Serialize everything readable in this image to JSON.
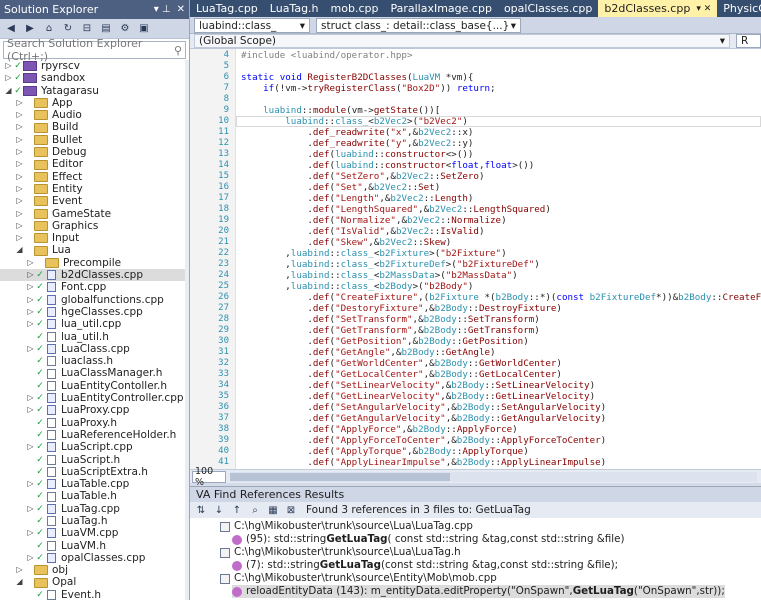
{
  "solution_explorer": {
    "title": "Solution Explorer",
    "pin_icon": "pin-icon",
    "close_icon": "close-icon",
    "search_placeholder": "Search Solution Explorer (Ctrl+;)",
    "search_icon": "search-icon",
    "tree": [
      {
        "label": "rpyrscv",
        "indent": 0,
        "type": "proj",
        "expanded": false,
        "state": "✓"
      },
      {
        "label": "sandbox",
        "indent": 0,
        "type": "proj",
        "expanded": false,
        "state": "✓"
      },
      {
        "label": "Yatagarasu",
        "indent": 0,
        "type": "proj",
        "expanded": true,
        "state": "✓"
      },
      {
        "label": "App",
        "indent": 1,
        "type": "folder",
        "expanded": false
      },
      {
        "label": "Audio",
        "indent": 1,
        "type": "folder",
        "expanded": false
      },
      {
        "label": "Build",
        "indent": 1,
        "type": "folder",
        "expanded": false
      },
      {
        "label": "Bullet",
        "indent": 1,
        "type": "folder",
        "expanded": false
      },
      {
        "label": "Debug",
        "indent": 1,
        "type": "folder",
        "expanded": false
      },
      {
        "label": "Editor",
        "indent": 1,
        "type": "folder",
        "expanded": false
      },
      {
        "label": "Effect",
        "indent": 1,
        "type": "folder",
        "expanded": false
      },
      {
        "label": "Entity",
        "indent": 1,
        "type": "folder",
        "expanded": false
      },
      {
        "label": "Event",
        "indent": 1,
        "type": "folder",
        "expanded": false
      },
      {
        "label": "GameState",
        "indent": 1,
        "type": "folder",
        "expanded": false
      },
      {
        "label": "Graphics",
        "indent": 1,
        "type": "folder",
        "expanded": false
      },
      {
        "label": "Input",
        "indent": 1,
        "type": "folder",
        "expanded": false
      },
      {
        "label": "Lua",
        "indent": 1,
        "type": "folder",
        "expanded": true
      },
      {
        "label": "Precompile",
        "indent": 2,
        "type": "folder",
        "expanded": false
      },
      {
        "label": "b2dClasses.cpp",
        "indent": 2,
        "type": "cpp",
        "expanded": false,
        "state": "✓",
        "selected": true
      },
      {
        "label": "Font.cpp",
        "indent": 2,
        "type": "cpp",
        "expanded": false,
        "state": "✓"
      },
      {
        "label": "globalfunctions.cpp",
        "indent": 2,
        "type": "cpp",
        "expanded": false,
        "state": "✓"
      },
      {
        "label": "hgeClasses.cpp",
        "indent": 2,
        "type": "cpp",
        "expanded": false,
        "state": "✓"
      },
      {
        "label": "lua_util.cpp",
        "indent": 2,
        "type": "cpp",
        "expanded": false,
        "state": "✓"
      },
      {
        "label": "lua_util.h",
        "indent": 2,
        "type": "h",
        "expanded": false,
        "state": "✓"
      },
      {
        "label": "LuaClass.cpp",
        "indent": 2,
        "type": "cpp",
        "expanded": false,
        "state": "✓"
      },
      {
        "label": "luaclass.h",
        "indent": 2,
        "type": "h",
        "expanded": false,
        "state": "✓"
      },
      {
        "label": "LuaClassManager.h",
        "indent": 2,
        "type": "h",
        "expanded": false,
        "state": "✓"
      },
      {
        "label": "LuaEntityContoller.h",
        "indent": 2,
        "type": "h",
        "expanded": false,
        "state": "✓"
      },
      {
        "label": "LuaEntityController.cpp",
        "indent": 2,
        "type": "cpp",
        "expanded": false,
        "state": "✓"
      },
      {
        "label": "LuaProxy.cpp",
        "indent": 2,
        "type": "cpp",
        "expanded": false,
        "state": "✓"
      },
      {
        "label": "LuaProxy.h",
        "indent": 2,
        "type": "h",
        "expanded": false,
        "state": "✓"
      },
      {
        "label": "LuaReferenceHolder.h",
        "indent": 2,
        "type": "h",
        "expanded": false,
        "state": "✓"
      },
      {
        "label": "LuaScript.cpp",
        "indent": 2,
        "type": "cpp",
        "expanded": false,
        "state": "✓"
      },
      {
        "label": "LuaScript.h",
        "indent": 2,
        "type": "h",
        "expanded": false,
        "state": "✓"
      },
      {
        "label": "LuaScriptExtra.h",
        "indent": 2,
        "type": "h",
        "expanded": false,
        "state": "✓"
      },
      {
        "label": "LuaTable.cpp",
        "indent": 2,
        "type": "cpp",
        "expanded": false,
        "state": "✓"
      },
      {
        "label": "LuaTable.h",
        "indent": 2,
        "type": "h",
        "expanded": false,
        "state": "✓"
      },
      {
        "label": "LuaTag.cpp",
        "indent": 2,
        "type": "cpp",
        "expanded": false,
        "state": "✓"
      },
      {
        "label": "LuaTag.h",
        "indent": 2,
        "type": "h",
        "expanded": false,
        "state": "✓"
      },
      {
        "label": "LuaVM.cpp",
        "indent": 2,
        "type": "cpp",
        "expanded": false,
        "state": "✓"
      },
      {
        "label": "LuaVM.h",
        "indent": 2,
        "type": "h",
        "expanded": false,
        "state": "✓"
      },
      {
        "label": "opalClasses.cpp",
        "indent": 2,
        "type": "cpp",
        "expanded": false,
        "state": "✓"
      },
      {
        "label": "obj",
        "indent": 1,
        "type": "folder",
        "expanded": false
      },
      {
        "label": "Opal",
        "indent": 1,
        "type": "folder",
        "expanded": true
      },
      {
        "label": "Event.h",
        "indent": 2,
        "type": "h",
        "expanded": false,
        "state": "✓"
      }
    ]
  },
  "tabs": [
    {
      "label": "LuaTag.cpp",
      "active": false
    },
    {
      "label": "LuaTag.h",
      "active": false
    },
    {
      "label": "mob.cpp",
      "active": false
    },
    {
      "label": "ParallaxImage.cpp",
      "active": false
    },
    {
      "label": "opalClasses.cpp",
      "active": false
    },
    {
      "label": "b2dClasses.cpp",
      "active": true
    },
    {
      "label": "PhysicCompo",
      "active": false
    }
  ],
  "nav": {
    "symbol_combo": "luabind::class_",
    "scope_combo": "struct class_: detail::class_base{...}",
    "global_scope": "(Global Scope)",
    "right_combo": "R"
  },
  "editor": {
    "zoom": "100 %",
    "current_line": 10,
    "lines": [
      {
        "n": 4,
        "html": "<span class=\"inc\">#include &lt;luabind/operator.hpp&gt;</span>"
      },
      {
        "n": 5,
        "html": ""
      },
      {
        "n": 6,
        "html": "<span class=\"kw\">static void</span> <span class=\"fn\">RegisterB2DClasses</span>(<span class=\"ty\">LuaVM</span> *vm){"
      },
      {
        "n": 7,
        "html": "    <span class=\"kw\">if</span>(!vm-&gt;<span class=\"fn\">tryRegisterClass</span>(<span class=\"str\">\"Box2D\"</span>)) <span class=\"kw\">return</span>;"
      },
      {
        "n": 8,
        "html": ""
      },
      {
        "n": 9,
        "html": "    <span class=\"ty\">luabind</span>::<span class=\"fn\">module</span>(vm-&gt;<span class=\"fn\">getState</span>())["
      },
      {
        "n": 10,
        "html": "        <span class=\"ty\">luabind</span>::<span class=\"ty\">class_</span>&lt;<span class=\"ty\">b2Vec2</span>&gt;(<span class=\"str\">\"b2Vec2\"</span>)"
      },
      {
        "n": 11,
        "html": "            .<span class=\"fn\">def_readwrite</span>(<span class=\"str\">\"x\"</span>,&amp;<span class=\"ty\">b2Vec2</span>::x)"
      },
      {
        "n": 12,
        "html": "            .<span class=\"fn\">def_readwrite</span>(<span class=\"str\">\"y\"</span>,&amp;<span class=\"ty\">b2Vec2</span>::y)"
      },
      {
        "n": 13,
        "html": "            .<span class=\"fn\">def</span>(<span class=\"ty\">luabind</span>::<span class=\"fn\">constructor</span>&lt;&gt;())"
      },
      {
        "n": 14,
        "html": "            .<span class=\"fn\">def</span>(<span class=\"ty\">luabind</span>::<span class=\"fn\">constructor</span>&lt;<span class=\"kw\">float</span>,<span class=\"kw\">float</span>&gt;())"
      },
      {
        "n": 15,
        "html": "            .<span class=\"fn\">def</span>(<span class=\"str\">\"SetZero\"</span>,&amp;<span class=\"ty\">b2Vec2</span>::<span class=\"fn\">SetZero</span>)"
      },
      {
        "n": 16,
        "html": "            .<span class=\"fn\">def</span>(<span class=\"str\">\"Set\"</span>,&amp;<span class=\"ty\">b2Vec2</span>::<span class=\"fn\">Set</span>)"
      },
      {
        "n": 17,
        "html": "            .<span class=\"fn\">def</span>(<span class=\"str\">\"Length\"</span>,&amp;<span class=\"ty\">b2Vec2</span>::<span class=\"fn\">Length</span>)"
      },
      {
        "n": 18,
        "html": "            .<span class=\"fn\">def</span>(<span class=\"str\">\"LengthSquared\"</span>,&amp;<span class=\"ty\">b2Vec2</span>::<span class=\"fn\">LengthSquared</span>)"
      },
      {
        "n": 19,
        "html": "            .<span class=\"fn\">def</span>(<span class=\"str\">\"Normalize\"</span>,&amp;<span class=\"ty\">b2Vec2</span>::<span class=\"fn\">Normalize</span>)"
      },
      {
        "n": 20,
        "html": "            .<span class=\"fn\">def</span>(<span class=\"str\">\"IsValid\"</span>,&amp;<span class=\"ty\">b2Vec2</span>::<span class=\"fn\">IsValid</span>)"
      },
      {
        "n": 21,
        "html": "            .<span class=\"fn\">def</span>(<span class=\"str\">\"Skew\"</span>,&amp;<span class=\"ty\">b2Vec2</span>::<span class=\"fn\">Skew</span>)"
      },
      {
        "n": 22,
        "html": "        ,<span class=\"ty\">luabind</span>::<span class=\"ty\">class_</span>&lt;<span class=\"ty\">b2Fixture</span>&gt;(<span class=\"str\">\"b2Fixture\"</span>)"
      },
      {
        "n": 23,
        "html": "        ,<span class=\"ty\">luabind</span>::<span class=\"ty\">class_</span>&lt;<span class=\"ty\">b2FixtureDef</span>&gt;(<span class=\"str\">\"b2FixtureDef\"</span>)"
      },
      {
        "n": 24,
        "html": "        ,<span class=\"ty\">luabind</span>::<span class=\"ty\">class_</span>&lt;<span class=\"ty\">b2MassData</span>&gt;(<span class=\"str\">\"b2MassData\"</span>)"
      },
      {
        "n": 25,
        "html": "        ,<span class=\"ty\">luabind</span>::<span class=\"ty\">class_</span>&lt;<span class=\"ty\">b2Body</span>&gt;(<span class=\"str\">\"b2Body\"</span>)"
      },
      {
        "n": 26,
        "html": "            .<span class=\"fn\">def</span>(<span class=\"str\">\"CreateFixture\"</span>,(<span class=\"ty\">b2Fixture</span> *(<span class=\"ty\">b2Body</span>::*)(<span class=\"kw\">const</span> <span class=\"ty\">b2FixtureDef</span>*))&amp;<span class=\"ty\">b2Body</span>::<span class=\"fn\">CreateFixture</span>)"
      },
      {
        "n": 27,
        "html": "            .<span class=\"fn\">def</span>(<span class=\"str\">\"DestoryFixture\"</span>,&amp;<span class=\"ty\">b2Body</span>::<span class=\"fn\">DestroyFixture</span>)"
      },
      {
        "n": 28,
        "html": "            .<span class=\"fn\">def</span>(<span class=\"str\">\"SetTransform\"</span>,&amp;<span class=\"ty\">b2Body</span>::<span class=\"fn\">SetTransform</span>)"
      },
      {
        "n": 29,
        "html": "            .<span class=\"fn\">def</span>(<span class=\"str\">\"GetTransform\"</span>,&amp;<span class=\"ty\">b2Body</span>::<span class=\"fn\">GetTransform</span>)"
      },
      {
        "n": 30,
        "html": "            .<span class=\"fn\">def</span>(<span class=\"str\">\"GetPosition\"</span>,&amp;<span class=\"ty\">b2Body</span>::<span class=\"fn\">GetPosition</span>)"
      },
      {
        "n": 31,
        "html": "            .<span class=\"fn\">def</span>(<span class=\"str\">\"GetAngle\"</span>,&amp;<span class=\"ty\">b2Body</span>::<span class=\"fn\">GetAngle</span>)"
      },
      {
        "n": 32,
        "html": "            .<span class=\"fn\">def</span>(<span class=\"str\">\"GetWorldCenter\"</span>,&amp;<span class=\"ty\">b2Body</span>::<span class=\"fn\">GetWorldCenter</span>)"
      },
      {
        "n": 33,
        "html": "            .<span class=\"fn\">def</span>(<span class=\"str\">\"GetLocalCenter\"</span>,&amp;<span class=\"ty\">b2Body</span>::<span class=\"fn\">GetLocalCenter</span>)"
      },
      {
        "n": 34,
        "html": "            .<span class=\"fn\">def</span>(<span class=\"str\">\"SetLinearVelocity\"</span>,&amp;<span class=\"ty\">b2Body</span>::<span class=\"fn\">SetLinearVelocity</span>)"
      },
      {
        "n": 35,
        "html": "            .<span class=\"fn\">def</span>(<span class=\"str\">\"GetLinearVelocity\"</span>,&amp;<span class=\"ty\">b2Body</span>::<span class=\"fn\">GetLinearVelocity</span>)"
      },
      {
        "n": 36,
        "html": "            .<span class=\"fn\">def</span>(<span class=\"str\">\"SetAngularVelocity\"</span>,&amp;<span class=\"ty\">b2Body</span>::<span class=\"fn\">SetAngularVelocity</span>)"
      },
      {
        "n": 37,
        "html": "            .<span class=\"fn\">def</span>(<span class=\"str\">\"GetAngularVelocity\"</span>,&amp;<span class=\"ty\">b2Body</span>::<span class=\"fn\">GetAngularVelocity</span>)"
      },
      {
        "n": 38,
        "html": "            .<span class=\"fn\">def</span>(<span class=\"str\">\"ApplyForce\"</span>,&amp;<span class=\"ty\">b2Body</span>::<span class=\"fn\">ApplyForce</span>)"
      },
      {
        "n": 39,
        "html": "            .<span class=\"fn\">def</span>(<span class=\"str\">\"ApplyForceToCenter\"</span>,&amp;<span class=\"ty\">b2Body</span>::<span class=\"fn\">ApplyForceToCenter</span>)"
      },
      {
        "n": 40,
        "html": "            .<span class=\"fn\">def</span>(<span class=\"str\">\"ApplyTorque\"</span>,&amp;<span class=\"ty\">b2Body</span>::<span class=\"fn\">ApplyTorque</span>)"
      },
      {
        "n": 41,
        "html": "            .<span class=\"fn\">def</span>(<span class=\"str\">\"ApplyLinearImpulse\"</span>,&amp;<span class=\"ty\">b2Body</span>::<span class=\"fn\">ApplyLinearImpulse</span>)"
      }
    ]
  },
  "va": {
    "title": "VA Find References Results",
    "summary": "Found 3 references in 3 files to: GetLuaTag",
    "results": [
      {
        "kind": "file",
        "text": "C:\\hg\\Mikobuster\\trunk\\source\\Lua\\LuaTag.cpp"
      },
      {
        "kind": "ref",
        "prefix": "(95):   std::string ",
        "match": "GetLuaTag",
        "suffix": "( const std::string &tag,const std::string &file)"
      },
      {
        "kind": "file",
        "text": "C:\\hg\\Mikobuster\\trunk\\source\\Lua\\LuaTag.h"
      },
      {
        "kind": "ref",
        "prefix": "(7):   std::string ",
        "match": "GetLuaTag",
        "suffix": "(const std::string &tag,const std::string &file);"
      },
      {
        "kind": "file",
        "text": "C:\\hg\\Mikobuster\\trunk\\source\\Entity\\Mob\\mob.cpp"
      },
      {
        "kind": "ref",
        "prefix": "reloadEntityData (143):   m_entityData.editProperty(\"OnSpawn\",",
        "match": "GetLuaTag",
        "suffix": "(\"OnSpawn\",str));",
        "selected": true
      }
    ]
  },
  "colors": {
    "title_bar": "#4d6082",
    "tab_strip": "#364e6f",
    "active_tab": "#fff1a8",
    "keyword": "#0000ff",
    "string": "#a31515",
    "type": "#2b91af"
  }
}
